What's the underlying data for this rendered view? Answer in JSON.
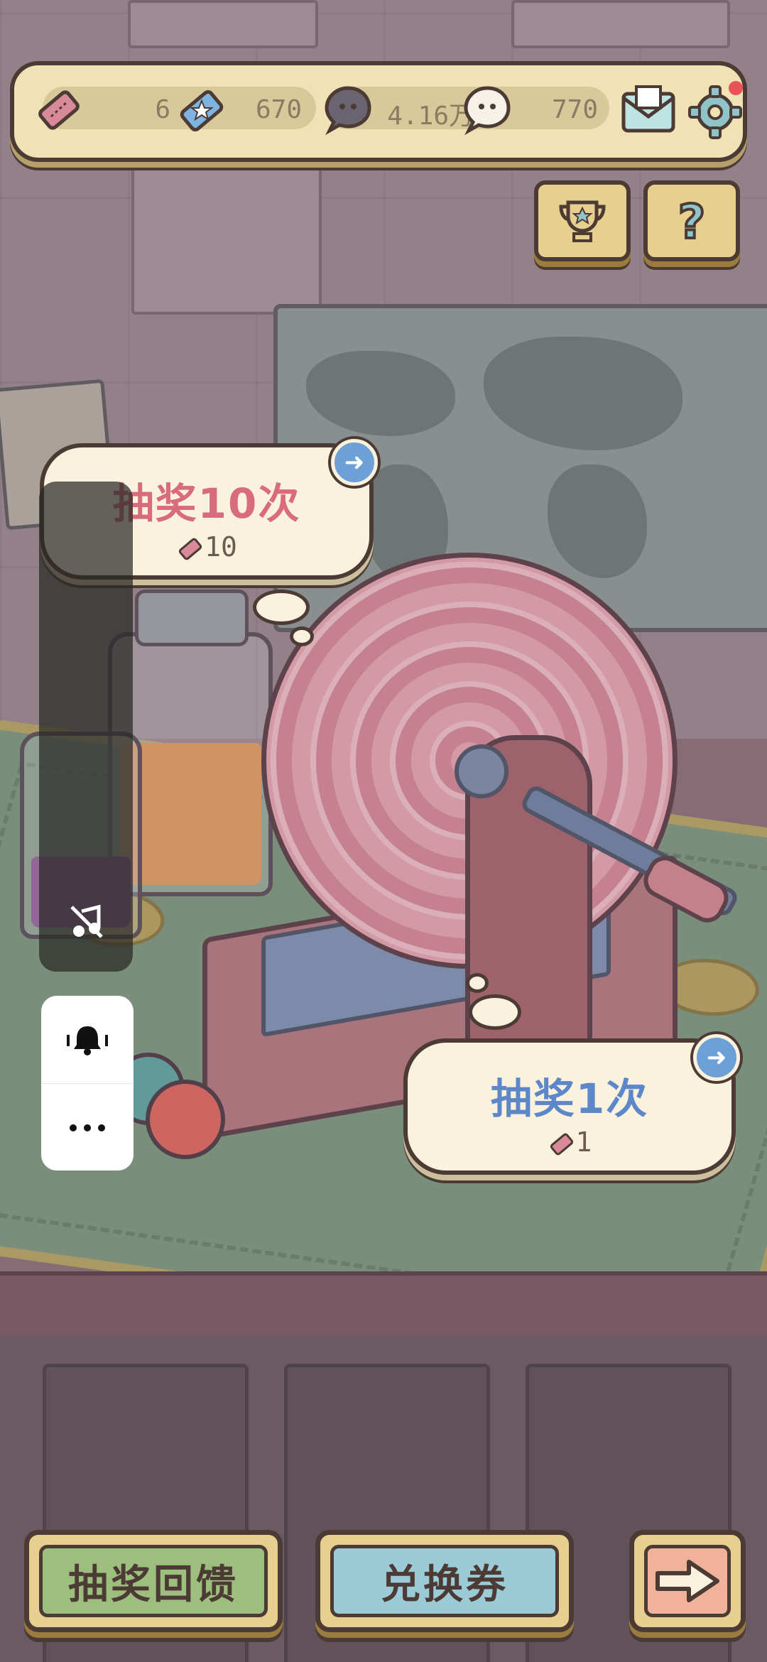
{
  "hud": {
    "tickets": "6",
    "stars": "670",
    "dark_coins": "4.16万",
    "light_coins": "770",
    "settings_has_notification": true
  },
  "actions": {
    "draw10": {
      "title": "抽奖10次",
      "cost": "10"
    },
    "draw1": {
      "title": "抽奖1次",
      "cost": "1"
    }
  },
  "bottom": {
    "feedback_label": "抽奖回馈",
    "exchange_label": "兑换券"
  },
  "colors": {
    "hud_bg": "#f1e2b6",
    "outline": "#4c3b35",
    "draw10_text": "#d86b7c",
    "draw1_text": "#5d87c9",
    "feedback_btn": "#9cbf7d",
    "exchange_btn": "#9ccbd8",
    "next_btn": "#f0b39a",
    "notify_dot": "#e8535a"
  },
  "icons": {
    "hud": [
      "ticket-icon",
      "star-ticket-icon",
      "dark-coin-icon",
      "light-coin-icon",
      "mail-icon",
      "settings-icon"
    ],
    "top_right": [
      "trophy-icon",
      "help-icon"
    ],
    "side": [
      "music-off-icon",
      "vibrate-bell-icon",
      "more-icon"
    ],
    "bottom": [
      "arrow-right-icon"
    ]
  }
}
